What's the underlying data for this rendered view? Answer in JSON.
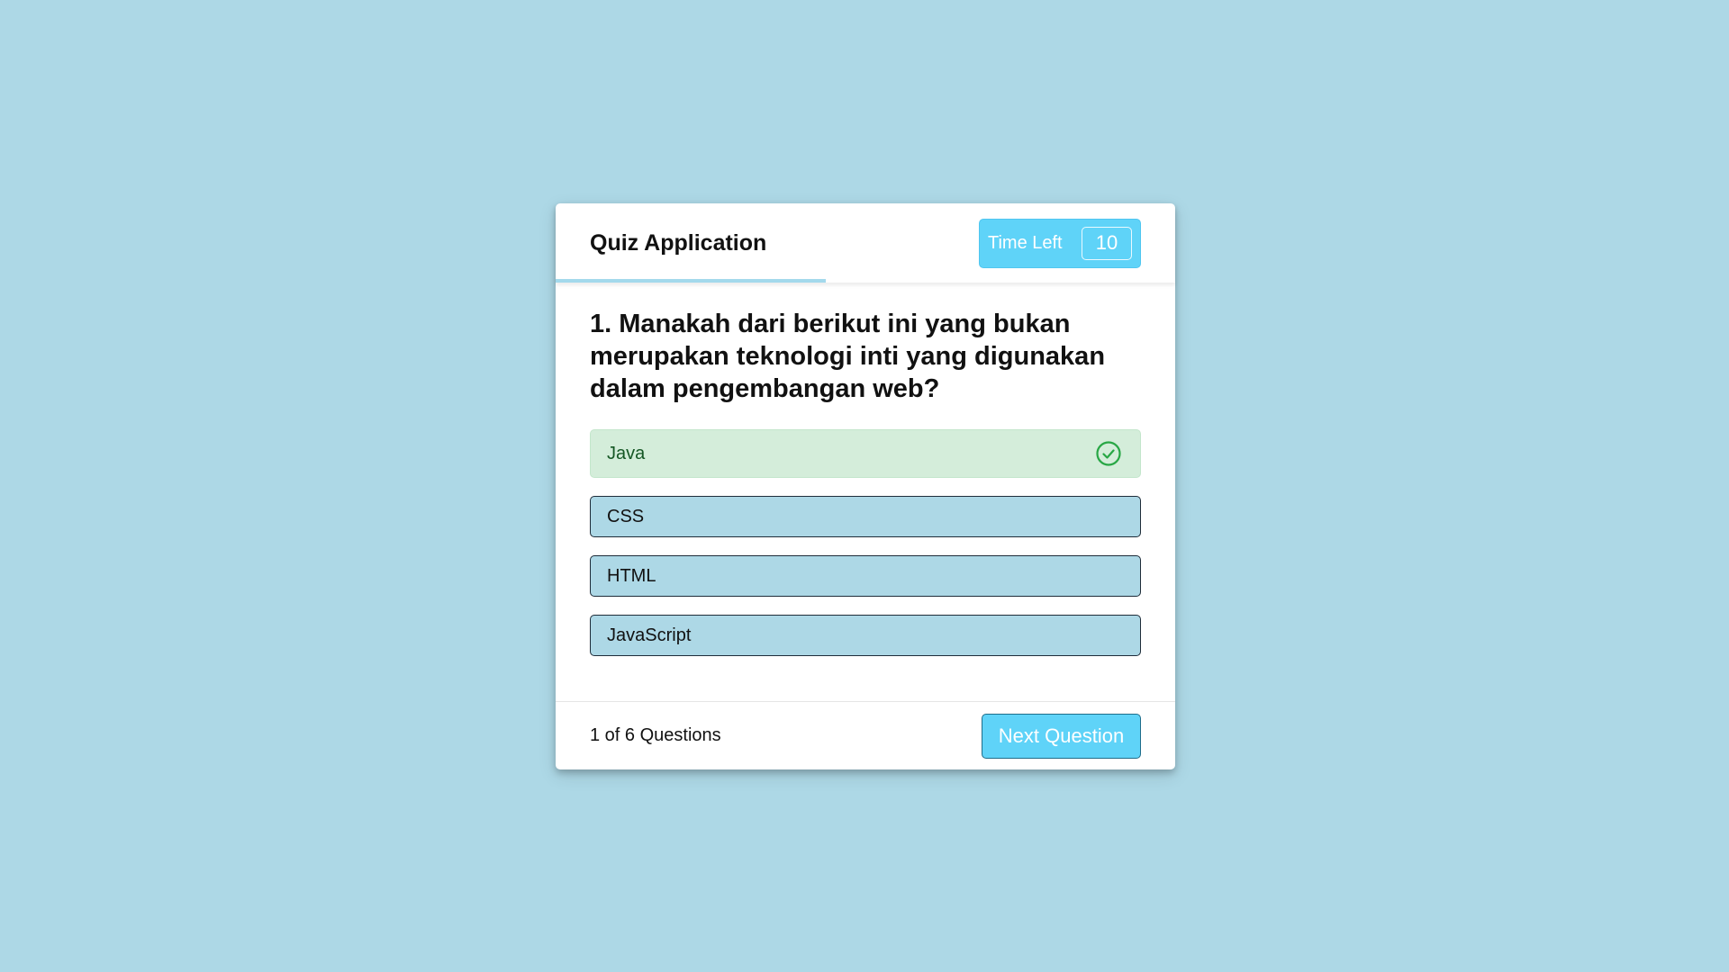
{
  "header": {
    "title": "Quiz Application",
    "time_label": "Time Left",
    "time_value": "10"
  },
  "question": {
    "text": "1. Manakah dari berikut ini yang bukan merupakan teknologi inti yang digunakan dalam pengembangan web?"
  },
  "options": [
    {
      "label": "Java",
      "state": "correct",
      "icon": "check-circle-icon"
    },
    {
      "label": "CSS",
      "state": "default"
    },
    {
      "label": "HTML",
      "state": "default"
    },
    {
      "label": "JavaScript",
      "state": "default"
    }
  ],
  "footer": {
    "counter": "1 of 6 Questions",
    "next_label": "Next Question"
  },
  "colors": {
    "background": "#add8e6",
    "accent": "#5fd3f8",
    "correct_bg": "#d4edda",
    "correct_text": "#155724"
  }
}
